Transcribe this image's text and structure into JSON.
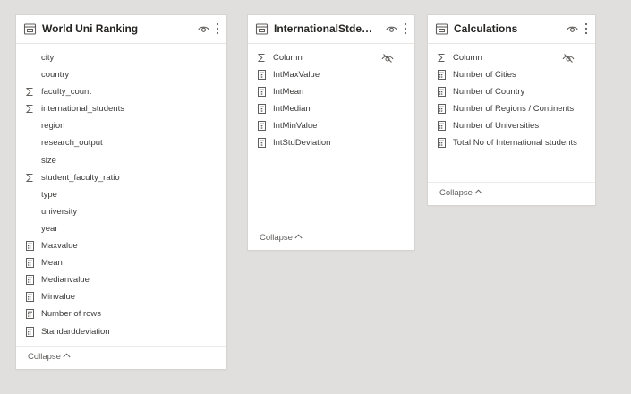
{
  "tables": [
    {
      "title": "World Uni Ranking",
      "collapse_label": "Collapse",
      "fields": [
        {
          "label": "city",
          "icon": "none"
        },
        {
          "label": "country",
          "icon": "none"
        },
        {
          "label": "faculty_count",
          "icon": "sigma"
        },
        {
          "label": "international_students",
          "icon": "sigma"
        },
        {
          "label": "region",
          "icon": "none"
        },
        {
          "label": "research_output",
          "icon": "none"
        },
        {
          "label": "size",
          "icon": "none"
        },
        {
          "label": "student_faculty_ratio",
          "icon": "sigma"
        },
        {
          "label": "type",
          "icon": "none"
        },
        {
          "label": "university",
          "icon": "none"
        },
        {
          "label": "year",
          "icon": "none"
        },
        {
          "label": "Maxvalue",
          "icon": "calculator"
        },
        {
          "label": "Mean",
          "icon": "calculator"
        },
        {
          "label": "Medianvalue",
          "icon": "calculator"
        },
        {
          "label": "Minvalue",
          "icon": "calculator"
        },
        {
          "label": "Number of rows",
          "icon": "calculator"
        },
        {
          "label": "Standarddeviation",
          "icon": "calculator"
        }
      ]
    },
    {
      "title": "InternationalStdentsStats",
      "collapse_label": "Collapse",
      "fields": [
        {
          "label": "Column",
          "icon": "sigma",
          "hidden": true
        },
        {
          "label": "IntMaxValue",
          "icon": "calculator"
        },
        {
          "label": "IntMean",
          "icon": "calculator"
        },
        {
          "label": "IntMedian",
          "icon": "calculator"
        },
        {
          "label": "IntMinValue",
          "icon": "calculator"
        },
        {
          "label": "IntStdDeviation",
          "icon": "calculator"
        }
      ]
    },
    {
      "title": "Calculations",
      "collapse_label": "Collapse",
      "fields": [
        {
          "label": "Column",
          "icon": "sigma",
          "hidden": true
        },
        {
          "label": "Number of Cities",
          "icon": "calculator"
        },
        {
          "label": "Number of Country",
          "icon": "calculator"
        },
        {
          "label": "Number of Regions / Continents",
          "icon": "calculator"
        },
        {
          "label": "Number of Universities",
          "icon": "calculator"
        },
        {
          "label": "Total No of International students",
          "icon": "calculator"
        }
      ]
    }
  ],
  "colors": {
    "canvas": "#e1dfdd",
    "card": "#ffffff",
    "text": "#3b3a39",
    "icon": "#605e5c"
  }
}
